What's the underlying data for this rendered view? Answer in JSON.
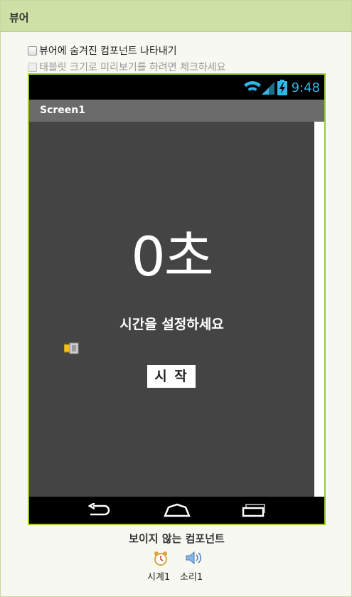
{
  "panel": {
    "title": "뷰어"
  },
  "options": {
    "show_hidden": "뷰어에 숨겨진 컴포넌트 나타내기",
    "tablet_preview": "태블릿 크기로 미리보기를 하려면 체크하세요"
  },
  "status_bar": {
    "time": "9:48"
  },
  "screen": {
    "title": "Screen1",
    "time_label": "0초",
    "instruction": "시간을 설정하세요",
    "start_button": "시 작"
  },
  "nonvisible": {
    "title": "보이지 않는 컴포넌트",
    "components": [
      {
        "name": "시계1",
        "icon": "clock-icon"
      },
      {
        "name": "소리1",
        "icon": "speaker-icon"
      }
    ]
  },
  "colors": {
    "header": "#cfe0a7",
    "phone_border": "#9ccc2e",
    "status_time": "#33b5e5",
    "screen_bg": "#444444"
  }
}
